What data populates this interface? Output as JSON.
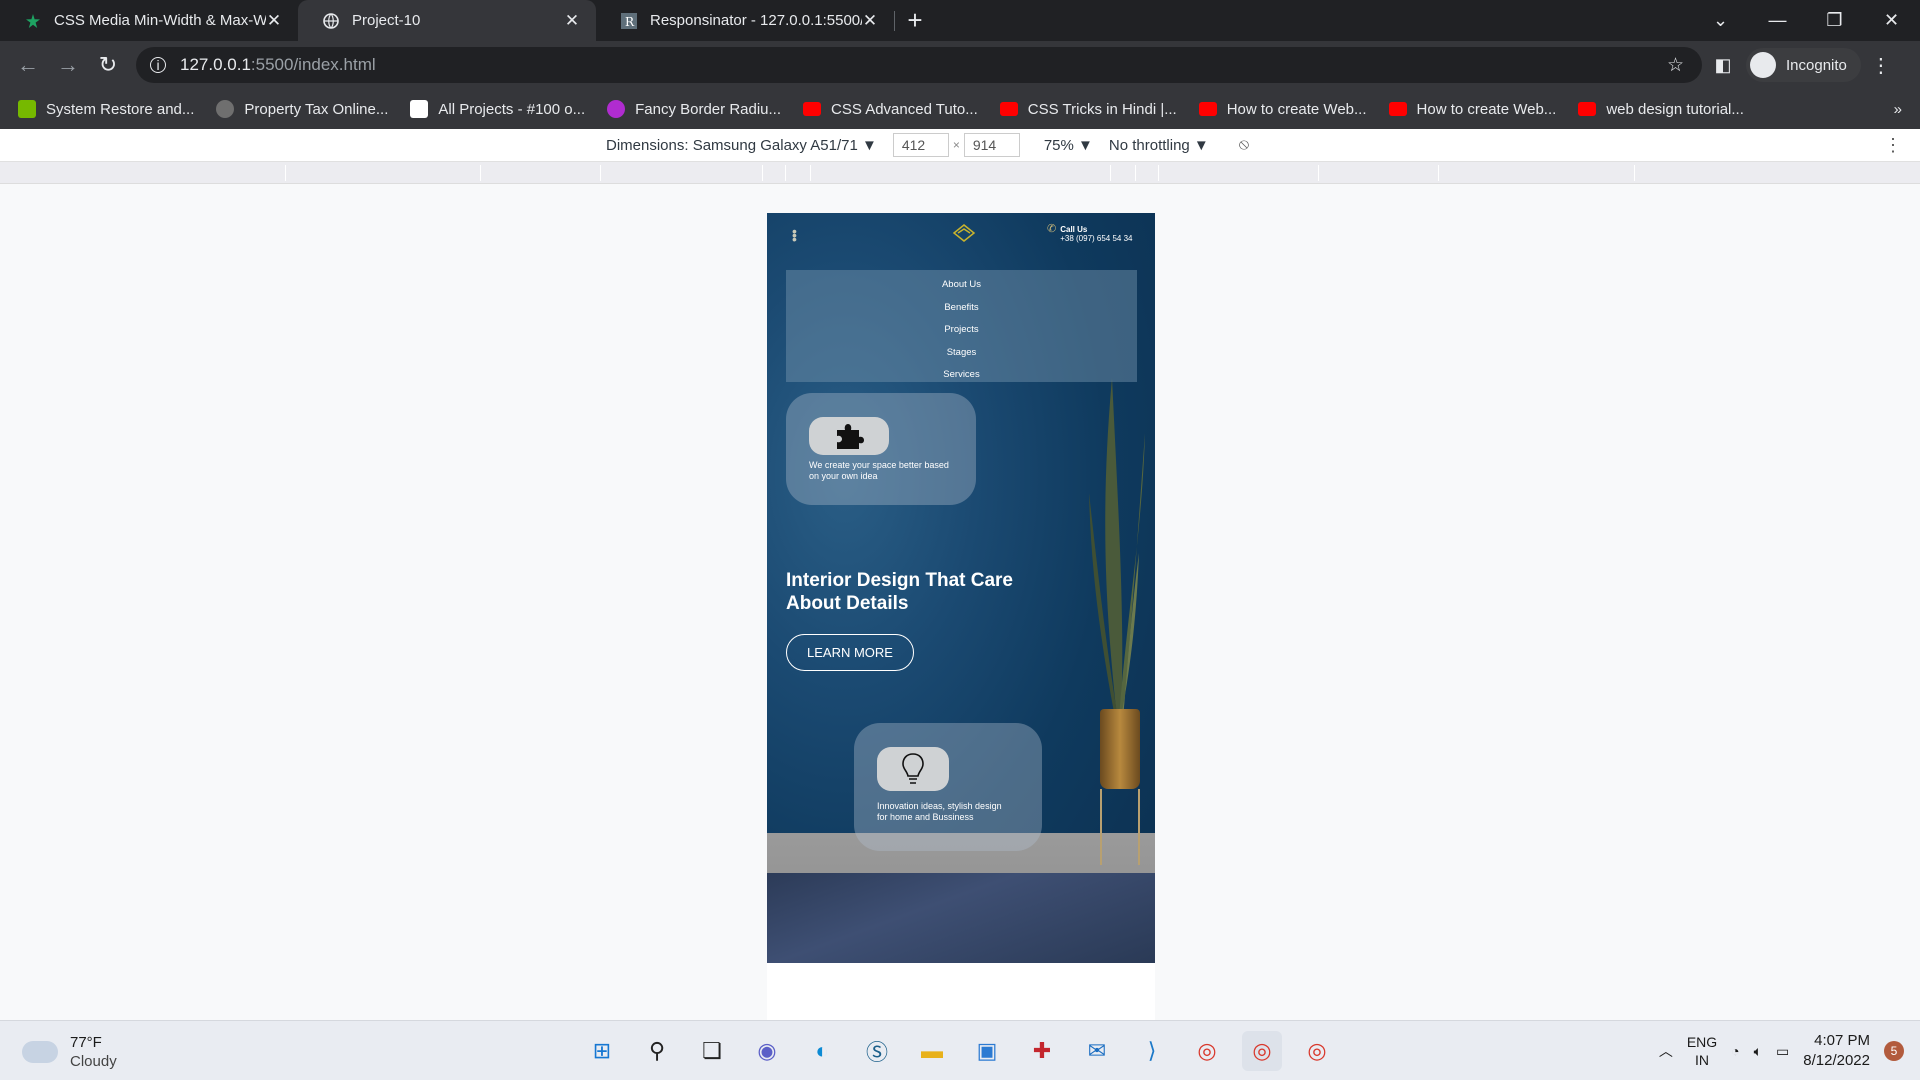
{
  "tabs": [
    {
      "title": "CSS Media Min-Width & Max-W",
      "icon": "star-favicon-icon",
      "color": "#1ea362"
    },
    {
      "title": "Project-10",
      "icon": "globe-icon",
      "active": true
    },
    {
      "title": "Responsinator - 127.0.0.1:5500/in",
      "icon": "r-favicon-icon"
    }
  ],
  "address": {
    "host": "127.0.0.1",
    "rest": ":5500/index.html"
  },
  "profile": {
    "label": "Incognito"
  },
  "bookmarks": [
    {
      "label": "System Restore and...",
      "color": "#76b900"
    },
    {
      "label": "Property Tax Online...",
      "color": "#6f6f6f"
    },
    {
      "label": "All Projects - #100 o...",
      "color": "#ffffff"
    },
    {
      "label": "Fancy Border Radiu...",
      "color": "#b02cd0"
    },
    {
      "label": "CSS Advanced Tuto...",
      "color": "#ff0000"
    },
    {
      "label": "CSS Tricks in Hindi |...",
      "color": "#ff0000"
    },
    {
      "label": "How to create Web...",
      "color": "#ff0000"
    },
    {
      "label": "How to create Web...",
      "color": "#ff0000"
    },
    {
      "label": "web design tutorial...",
      "color": "#ff0000"
    }
  ],
  "devtools": {
    "dimensions": "Dimensions: Samsung Galaxy A51/71",
    "width": "412",
    "height": "914",
    "times": "×",
    "zoom": "75%",
    "throttling": "No throttling"
  },
  "site": {
    "call_label": "Call Us",
    "call_number": "+38 (097) 654 54 34",
    "menu": [
      "About Us",
      "Benefits",
      "Projects",
      "Stages",
      "Services"
    ],
    "card1_text": "We create your space better based on your own idea",
    "card2_text": "Innovation ideas, stylish design for home and Bussiness",
    "heading": "Interior Design That Care About Details",
    "cta": "LEARN MORE"
  },
  "taskbar": {
    "temp": "77°F",
    "condition": "Cloudy",
    "lang1": "ENG",
    "lang2": "IN",
    "time": "4:07 PM",
    "date": "8/12/2022",
    "notifications": "5"
  }
}
